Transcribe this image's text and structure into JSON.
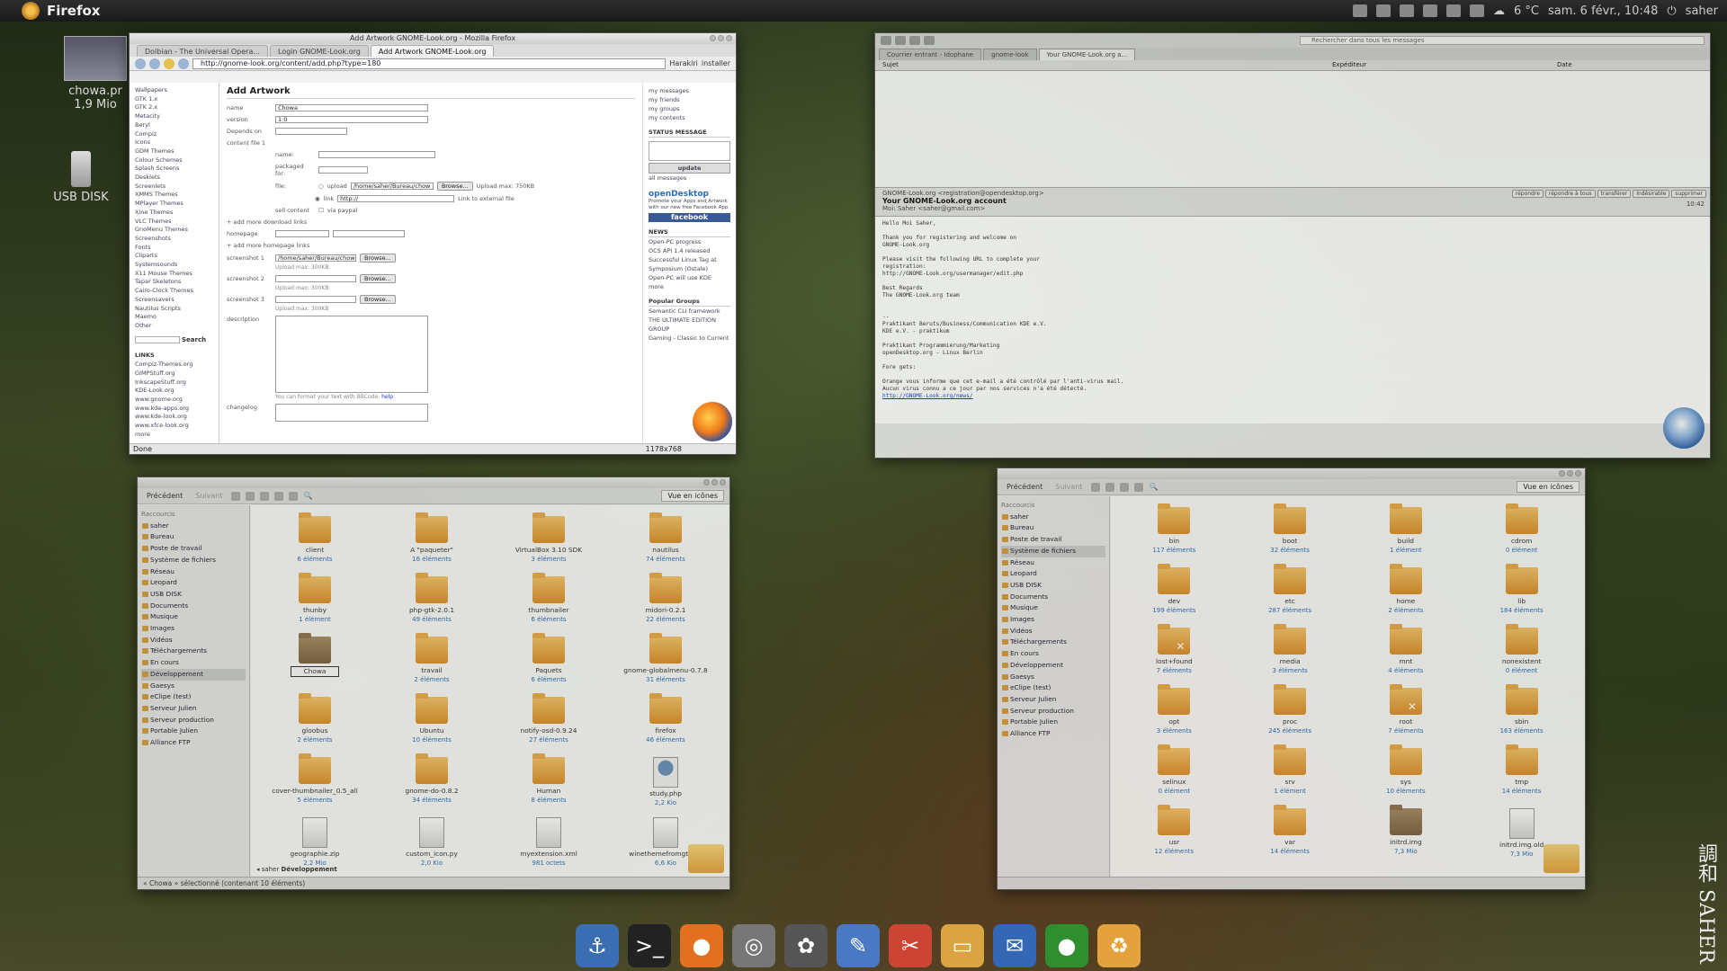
{
  "panel": {
    "app_name": "Firefox",
    "weather": "6 °C",
    "datetime": "sam. 6 févr., 10:48",
    "user": "saher"
  },
  "desktop": {
    "file_name": "chowa.pr",
    "file_size": "1,9 Mio",
    "usb_label": "USB DISK"
  },
  "firefox": {
    "title": "Add Artwork GNOME-Look.org - Mozilla Firefox",
    "tabs": [
      "Dolbian - The Universal Opera...",
      "Login GNOME-Look.org",
      "Add Artwork GNOME-Look.org"
    ],
    "url": "http://gnome-look.org/content/add.php?type=180",
    "bookmarks": [
      "Harakiri",
      "installer"
    ],
    "status": "Done",
    "left_nav": [
      "Wallpapers",
      "GTK 1.x",
      "GTK 2.x",
      "Metacity",
      "Beryl",
      "Compiz",
      "Icons",
      "GDM Themes",
      "Colour Schemes",
      "Splash Screens",
      "Desklets",
      "Screenlets",
      "XMMS Themes",
      "MPlayer Themes",
      "Xine Themes",
      "VLC Themes",
      "GnoMenu Themes",
      "Screenshots",
      "Fonts",
      "Cliparts",
      "Systemsounds",
      "X11 Mouse Themes",
      "Tapar Skeletons",
      "Cairo-Clock Themes",
      "Screensavers",
      "Nautilus Scripts",
      "Maemo",
      "Other"
    ],
    "search_label": "Search",
    "links_header": "LINKS",
    "links": [
      "Compiz-Themes.org",
      "GIMPStuff.org",
      "InkscapeStuff.org",
      "KDE-Look.org",
      "www.gnome.org",
      "www.kde-apps.org",
      "www.kde-look.org",
      "www.xfce-look.org"
    ],
    "more_label": "more",
    "page_title": "Add Artwork",
    "form": {
      "name_label": "name",
      "name_value": "Chowa",
      "version_label": "version",
      "version_value": "1.0",
      "depends_label": "Depends on",
      "content_file_label": "content file 1",
      "cf_name_label": "name:",
      "cf_packaged_label": "packaged for:",
      "cf_file_label": "file:",
      "upload_label": "upload",
      "upload_path": "/home/saher/Bureau/chow",
      "browse": "Browse...",
      "upload_max": "Upload max: 750KB",
      "link_label": "link",
      "link_value": "http://",
      "link_hint": "Link to external file",
      "sell_content_label": "sell content",
      "via_paypal": "via paypal",
      "add_download": "+ add more download links",
      "homepage_label": "homepage",
      "add_homepage": "+ add more homepage links",
      "screenshot1_label": "screenshot 1",
      "screenshot1_value": "/home/saher/Bureau/chow",
      "screenshot2_label": "screenshot 2",
      "screenshot3_label": "screenshot 3",
      "upload_max_ss": "Upload max: 300KB",
      "description_label": "description",
      "bbcode_hint": "You can format your text with BBCode:",
      "bbcode_link": "help",
      "changelog_label": "changelog"
    },
    "right": {
      "my_links": [
        "my messages",
        "my friends",
        "my groups",
        "my contents"
      ],
      "status_header": "STATUS MESSAGE",
      "update": "update",
      "all_messages": "all messages",
      "opendesktop": "openDesktop",
      "opendesktop_tagline": "Promote your Apps and Artwork with our new free Facebook App",
      "facebook": "facebook",
      "news_header": "NEWS",
      "news": [
        "Open-PC progress",
        "OCS API 1.4 released",
        "Successful Linux Tag at Symposium (Ostale)",
        "Open-PC will use KDE"
      ],
      "news_more": "more",
      "groups_header": "Popular Groups",
      "groups": [
        "Semantic CLI framework",
        "THE ULTIMATE EDITION GROUP",
        "Gaming - Classic to Current"
      ],
      "page_size": "1178x768"
    }
  },
  "thunderbird": {
    "search_placeholder": "Rechercher dans tous les messages",
    "tabs": [
      "Courrier entrant - Idophane",
      "gnome-look",
      "Your GNOME-Look.org a..."
    ],
    "columns": [
      "Sujet",
      "Expéditeur",
      "Date"
    ],
    "from": "GNOME-Look.org <registration@opendesktop.org>",
    "subject": "Your GNOME-Look.org account",
    "to": "Moi: Saher <saher@gmail.com>",
    "time": "10:42",
    "actions": [
      "répondre",
      "répondre à tous",
      "transférer",
      "indésirable",
      "supprimer"
    ],
    "body_lines": [
      "Hello Moi Saher,",
      "",
      "Thank you for registering and welcome on",
      "GNOME-Look.org",
      "",
      "Please visit the following URL to complete your",
      "registration:",
      "http://GNOME-Look.org/usermanager/edit.php",
      "",
      "Best Regards",
      "The GNOME-Look.org team",
      "",
      "",
      "-- ",
      "Praktikant Beruts/Business/Communication KDE e.V.",
      "KDE e.V. - praktikum",
      "",
      "Praktikant Programmierung/Marketing",
      "openDesktop.org - Linux Berlin",
      "",
      "Fore gets:",
      "",
      "Orange vous informe que cet e-mail a été contrôlé par l'anti-virus mail.",
      "Aucun virus connu a ce jour par nos services n'a été détecté."
    ],
    "link": "http://GNOME-Look.org/news/"
  },
  "nautilus1": {
    "back": "Précédent",
    "forward": "Suivant",
    "view": "Vue en icônes",
    "places_header": "Raccourcis",
    "places": [
      "saher",
      "Bureau",
      "Poste de travail",
      "Système de fichiers",
      "Réseau",
      "Leopard",
      "USB DISK",
      "Documents",
      "Musique",
      "Images",
      "Vidéos",
      "Téléchargements",
      "En cours",
      "Développement",
      "Gaesys",
      "eClipe (test)",
      "Serveur Julien",
      "Serveur production",
      "Portable Julien",
      "Alliance FTP"
    ],
    "selected_place_index": 13,
    "items": [
      {
        "name": "client",
        "meta": "6 éléments",
        "kind": "folder"
      },
      {
        "name": "A \"paqueter\"",
        "meta": "16 éléments",
        "kind": "folder"
      },
      {
        "name": "VirtualBox 3.10 SDK",
        "meta": "3 éléments",
        "kind": "folder"
      },
      {
        "name": "nautilus",
        "meta": "74 éléments",
        "kind": "folder"
      },
      {
        "name": "thunby",
        "meta": "1 élément",
        "kind": "folder"
      },
      {
        "name": "php-gtk-2.0.1",
        "meta": "49 éléments",
        "kind": "folder"
      },
      {
        "name": "thumbnailer",
        "meta": "6 éléments",
        "kind": "folder"
      },
      {
        "name": "midori-0.2.1",
        "meta": "22 éléments",
        "kind": "folder"
      },
      {
        "name": "Chowa",
        "meta": "",
        "kind": "brown"
      },
      {
        "name": "travail",
        "meta": "2 éléments",
        "kind": "folder"
      },
      {
        "name": "Paquets",
        "meta": "6 éléments",
        "kind": "folder"
      },
      {
        "name": "gnome-globalmenu-0.7.8",
        "meta": "31 éléments",
        "kind": "folder"
      },
      {
        "name": "gloobus",
        "meta": "2 éléments",
        "kind": "folder"
      },
      {
        "name": "Ubuntu",
        "meta": "10 éléments",
        "kind": "folder"
      },
      {
        "name": "notify-osd-0.9.24",
        "meta": "27 éléments",
        "kind": "folder"
      },
      {
        "name": "firefox",
        "meta": "46 éléments",
        "kind": "folder"
      },
      {
        "name": "cover-thumbnailer_0.5_all",
        "meta": "5 éléments",
        "kind": "folder"
      },
      {
        "name": "gnome-do-0.8.2",
        "meta": "34 éléments",
        "kind": "folder"
      },
      {
        "name": "Human",
        "meta": "8 éléments",
        "kind": "folder"
      },
      {
        "name": "study.php",
        "meta": "2,2 Kio",
        "kind": "php"
      },
      {
        "name": "geographie.zip",
        "meta": "2,2 Mio",
        "kind": "zip"
      },
      {
        "name": "custom_icon.py",
        "meta": "2,0 Kio",
        "kind": "file"
      },
      {
        "name": "myextension.xml",
        "meta": "981 octets",
        "kind": "file"
      },
      {
        "name": "winethemefromgtk.py",
        "meta": "6,6 Kio",
        "kind": "file"
      }
    ],
    "selected_item_index": 8,
    "breadcrumb": [
      "saher",
      "Développement"
    ],
    "status": "« Chowa » sélectionné (contenant 10 éléments)"
  },
  "nautilus2": {
    "back": "Précédent",
    "forward": "Suivant",
    "view": "Vue en icônes",
    "places_header": "Raccourcis",
    "places": [
      "saher",
      "Bureau",
      "Poste de travail",
      "Système de fichiers",
      "Réseau",
      "Leopard",
      "USB DISK",
      "Documents",
      "Musique",
      "Images",
      "Vidéos",
      "Téléchargements",
      "En cours",
      "Développement",
      "Gaesys",
      "eClipe (test)",
      "Serveur Julien",
      "Serveur production",
      "Portable Julien",
      "Alliance FTP"
    ],
    "selected_place_index": 3,
    "items": [
      {
        "name": "bin",
        "meta": "117 éléments",
        "kind": "folder"
      },
      {
        "name": "boot",
        "meta": "32 éléments",
        "kind": "folder"
      },
      {
        "name": "build",
        "meta": "1 élément",
        "kind": "folder"
      },
      {
        "name": "cdrom",
        "meta": "0 élément",
        "kind": "folder"
      },
      {
        "name": "dev",
        "meta": "199 éléments",
        "kind": "folder"
      },
      {
        "name": "etc",
        "meta": "287 éléments",
        "kind": "folder"
      },
      {
        "name": "home",
        "meta": "2 éléments",
        "kind": "folder"
      },
      {
        "name": "lib",
        "meta": "184 éléments",
        "kind": "folder"
      },
      {
        "name": "lost+found",
        "meta": "7 éléments",
        "kind": "x"
      },
      {
        "name": "media",
        "meta": "3 éléments",
        "kind": "folder"
      },
      {
        "name": "mnt",
        "meta": "4 éléments",
        "kind": "folder"
      },
      {
        "name": "nonexistent",
        "meta": "0 élément",
        "kind": "folder"
      },
      {
        "name": "opt",
        "meta": "3 éléments",
        "kind": "folder"
      },
      {
        "name": "proc",
        "meta": "245 éléments",
        "kind": "folder"
      },
      {
        "name": "root",
        "meta": "7 éléments",
        "kind": "x"
      },
      {
        "name": "sbin",
        "meta": "163 éléments",
        "kind": "folder"
      },
      {
        "name": "selinux",
        "meta": "0 élément",
        "kind": "folder"
      },
      {
        "name": "srv",
        "meta": "1 élément",
        "kind": "folder"
      },
      {
        "name": "sys",
        "meta": "10 éléments",
        "kind": "folder"
      },
      {
        "name": "tmp",
        "meta": "14 éléments",
        "kind": "folder"
      },
      {
        "name": "usr",
        "meta": "12 éléments",
        "kind": "folder"
      },
      {
        "name": "var",
        "meta": "14 éléments",
        "kind": "folder"
      },
      {
        "name": "initrd.img",
        "meta": "7,3 Mio",
        "kind": "brown"
      },
      {
        "name": "initrd.img.old",
        "meta": "7,3 Mio",
        "kind": "file"
      }
    ]
  },
  "dock": [
    "anchor-icon",
    "terminal-icon",
    "firefox-icon",
    "disk-icon",
    "gimp-icon",
    "text-editor-icon",
    "settings-icon",
    "folder-icon",
    "thunderbird-icon",
    "green-orb-icon",
    "recycle-icon"
  ],
  "signature": "調和 SAHER"
}
